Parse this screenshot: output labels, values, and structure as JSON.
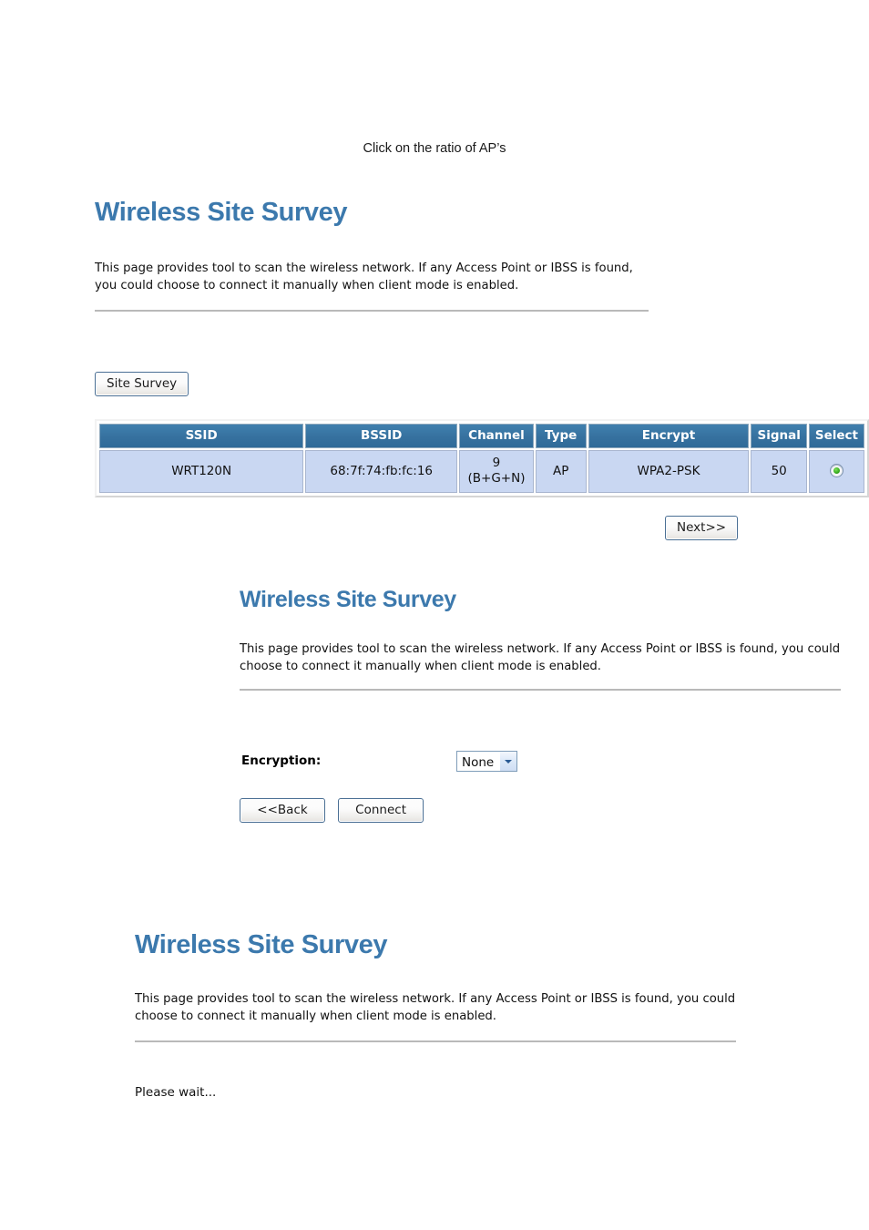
{
  "caption": {
    "text": "Click on the ratio of AP’s"
  },
  "colors": {
    "title_blue": "#3c79ad",
    "table_header_blue": "#36719f",
    "table_row_blue": "#c9d7f2",
    "rule_gray": "#b9b9b9",
    "radio_green": "#3aaf20"
  },
  "section_one": {
    "title": "Wireless Site Survey",
    "description": "This page provides tool to scan the wireless network. If any Access Point or IBSS is found, you could choose to connect it manually when client mode is enabled.",
    "site_survey_button": "Site Survey",
    "next_button": "Next>>",
    "table": {
      "columns": [
        "SSID",
        "BSSID",
        "Channel",
        "Type",
        "Encrypt",
        "Signal",
        "Select"
      ],
      "rows": [
        {
          "ssid": "WRT120N",
          "bssid": "68:7f:74:fb:fc:16",
          "channel_number": "9",
          "channel_band": "(B+G+N)",
          "type": "AP",
          "encrypt": "WPA2-PSK",
          "signal": "50",
          "selected": true
        }
      ]
    }
  },
  "section_two": {
    "title": "Wireless Site Survey",
    "description": "This page provides tool to scan the wireless network. If any Access Point or IBSS is found, you could choose to connect it manually when client mode is enabled.",
    "encryption_label": "Encryption:",
    "encryption_value": "None",
    "encryption_options": [
      "None"
    ],
    "back_button": "<<Back",
    "connect_button": "Connect"
  },
  "section_three": {
    "title": "Wireless Site Survey",
    "description": "This page provides tool to scan the wireless network. If any Access Point or IBSS is found, you could choose to connect it manually when client mode is enabled.",
    "status_text": "Please wait..."
  }
}
